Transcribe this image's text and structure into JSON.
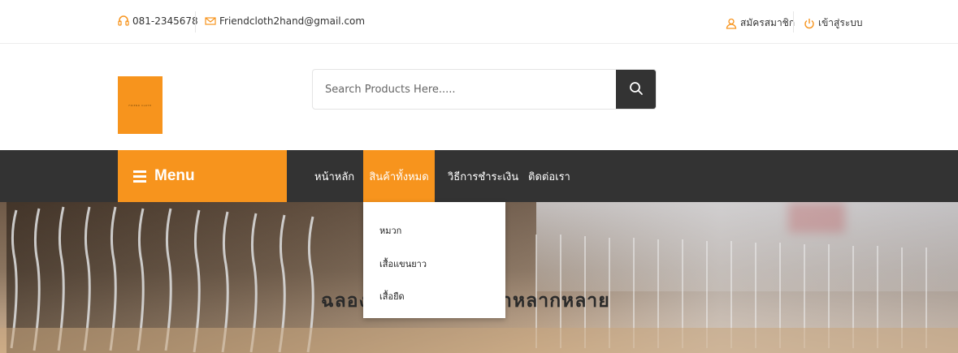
{
  "topbar": {
    "phone": "081-2345678",
    "email": "Friendcloth2hand@gmail.com",
    "register": "สมัครสมาชิก",
    "login": "เข้าสู่ระบบ",
    "phone_icon": "headset-icon",
    "email_icon": "envelope-icon",
    "register_icon": "user-icon",
    "login_icon": "power-icon"
  },
  "logo": {
    "text": "FRIEND CLOTH"
  },
  "search": {
    "placeholder": "Search Products Here.....",
    "value": ""
  },
  "nav": {
    "menu_label": "Menu",
    "items": [
      {
        "label": "หน้าหลัก"
      },
      {
        "label": "สินค้าทั้งหมด",
        "active": true
      },
      {
        "label": "วิธีการชำระเงิน"
      },
      {
        "label": "ติดต่อเรา"
      }
    ]
  },
  "dropdown": {
    "items": [
      {
        "label": "หมวก"
      },
      {
        "label": "เสื้อแขนยาว"
      },
      {
        "label": "เสื้อยืด"
      }
    ]
  },
  "hero": {
    "title": "ฉลองเทศกาลกับสินค้าหลากหลาย"
  },
  "colors": {
    "accent": "#f7941d",
    "dark": "#333333"
  }
}
